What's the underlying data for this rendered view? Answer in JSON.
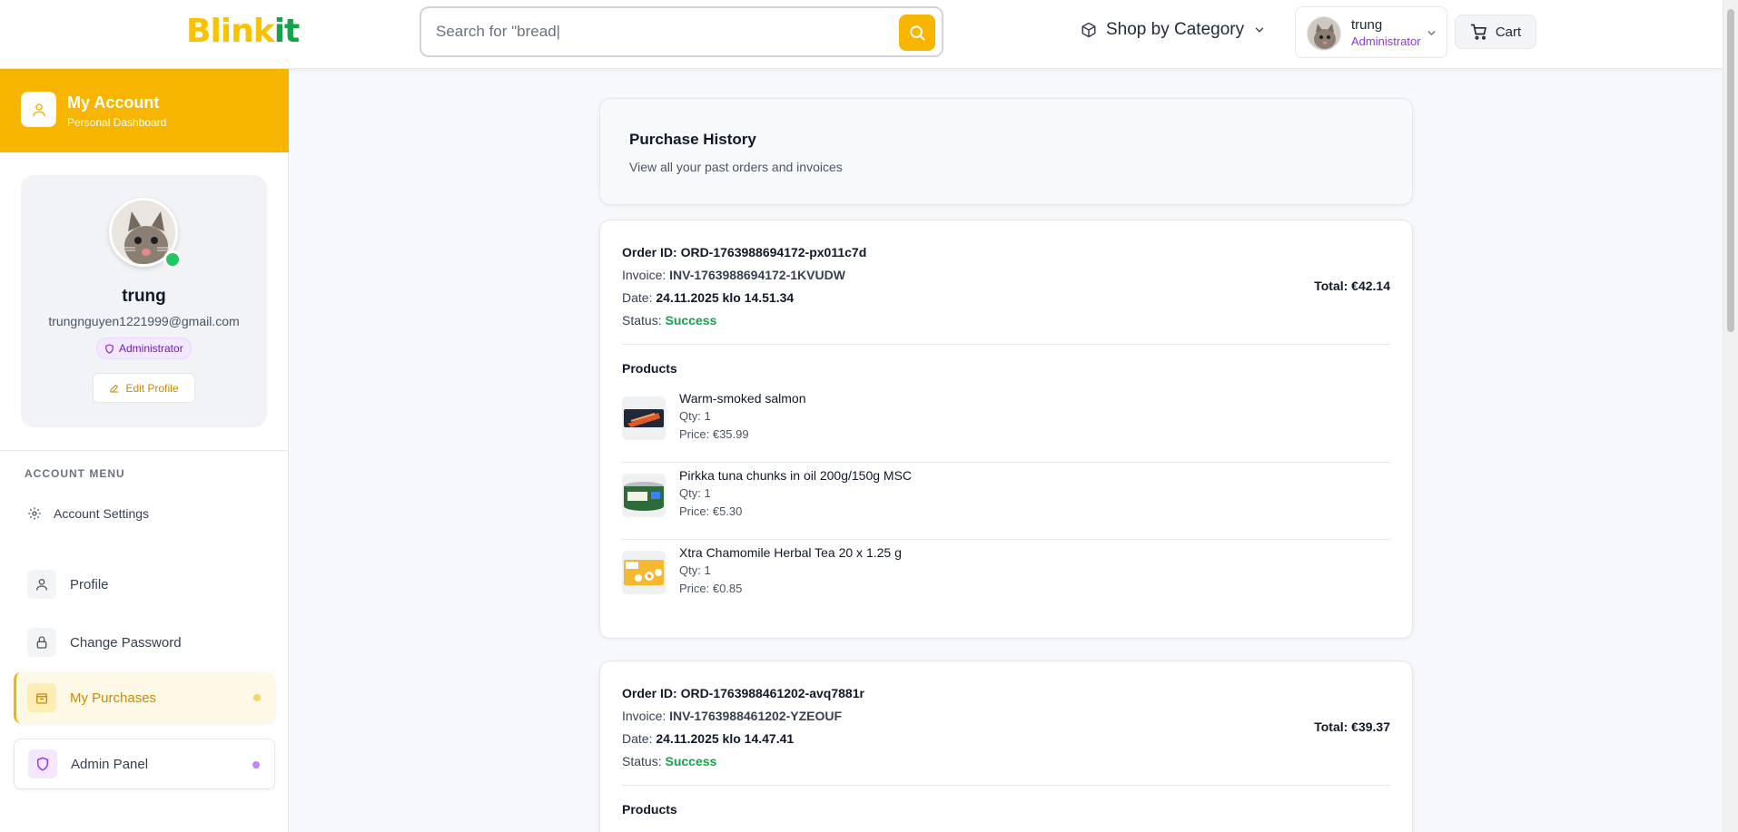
{
  "header": {
    "logo_part1": "Blink",
    "logo_part2": "it",
    "search_placeholder": "Search for \"bread|",
    "search_icon": "search-icon",
    "shop_category_label": "Shop by Category",
    "user_name": "trung",
    "user_role": "Administrator",
    "cart_label": "Cart"
  },
  "sidebar": {
    "title": "My Account",
    "subtitle": "Personal Dashboard",
    "profile": {
      "name": "trung",
      "email": "trungnguyen1221999@gmail.com",
      "role_badge": "Administrator",
      "edit_label": "Edit Profile"
    },
    "menu_title": "ACCOUNT MENU",
    "settings_label": "Account Settings",
    "items": [
      {
        "label": "Profile",
        "icon": "user-icon"
      },
      {
        "label": "Change Password",
        "icon": "lock-icon"
      },
      {
        "label": "My Purchases",
        "icon": "bag-icon"
      },
      {
        "label": "Admin Panel",
        "icon": "shield-icon"
      }
    ]
  },
  "colors": {
    "brand_yellow": "#f8b500",
    "brand_green": "#16a34a",
    "admin_purple": "#9333ea",
    "success_green": "#16a34a"
  },
  "main": {
    "title": "Purchase History",
    "subtitle": "View all your past orders and invoices",
    "orders": [
      {
        "id_label": "Order ID: ORD-1763988694172-px011c7d",
        "invoice_label": "Invoice:",
        "invoice": "INV-1763988694172-1KVUDW",
        "date_label": "Date:",
        "date": "24.11.2025 klo 14.51.34",
        "status_label": "Status:",
        "status": "Success",
        "total": "Total: €42.14",
        "products_label": "Products",
        "products": [
          {
            "name": "Warm-smoked salmon",
            "qty": "Qty: 1",
            "price": "Price: €35.99"
          },
          {
            "name": "Pirkka tuna chunks in oil 200g/150g MSC",
            "qty": "Qty: 1",
            "price": "Price: €5.30"
          },
          {
            "name": "Xtra Chamomile Herbal Tea 20 x 1.25 g",
            "qty": "Qty: 1",
            "price": "Price: €0.85"
          }
        ]
      },
      {
        "id_label": "Order ID: ORD-1763988461202-avq7881r",
        "invoice_label": "Invoice:",
        "invoice": "INV-1763988461202-YZEOUF",
        "date_label": "Date:",
        "date": "24.11.2025 klo 14.47.41",
        "status_label": "Status:",
        "status": "Success",
        "total": "Total: €39.37",
        "products_label": "Products"
      }
    ]
  }
}
